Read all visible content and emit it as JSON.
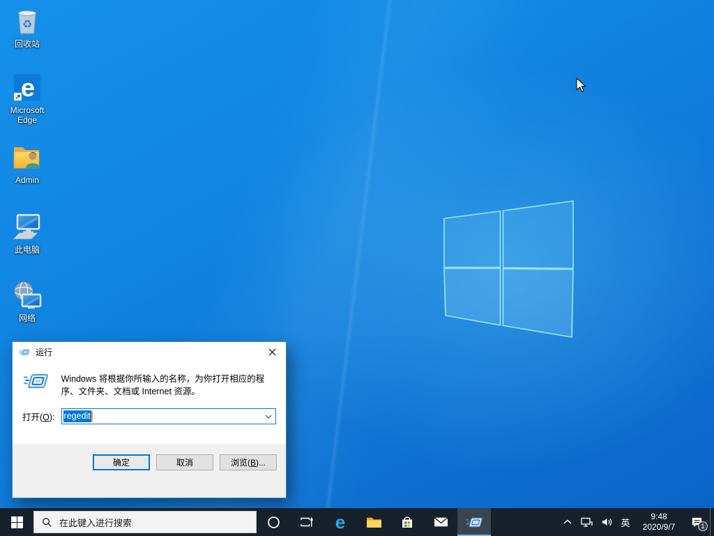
{
  "desktop_icons": [
    {
      "label": "回收站"
    },
    {
      "label": "Microsoft Edge"
    },
    {
      "label": "Admin"
    },
    {
      "label": "此电脑"
    },
    {
      "label": "网络"
    }
  ],
  "run_dialog": {
    "title": "运行",
    "description": "Windows 将根据你所输入的名称，为你打开相应的程序、文件夹、文档或 Internet 资源。",
    "open_label_prefix": "打开(",
    "open_label_mnemonic": "O",
    "open_label_suffix": "):",
    "input_value": "regedit",
    "ok_label": "确定",
    "cancel_label": "取消",
    "browse_label_prefix": "浏览(",
    "browse_label_mnemonic": "B",
    "browse_label_suffix": ")..."
  },
  "taskbar": {
    "search_placeholder": "在此键入进行搜索",
    "language": "英",
    "time": "9:48",
    "date": "2020/9/7",
    "notification_count": "1"
  },
  "icons": {
    "recycle": "♻"
  },
  "colors": {
    "accent": "#0078d7",
    "selection_bg": "#0078d7",
    "taskbar_bg": "#17212b",
    "caret": "#f7a23c"
  }
}
